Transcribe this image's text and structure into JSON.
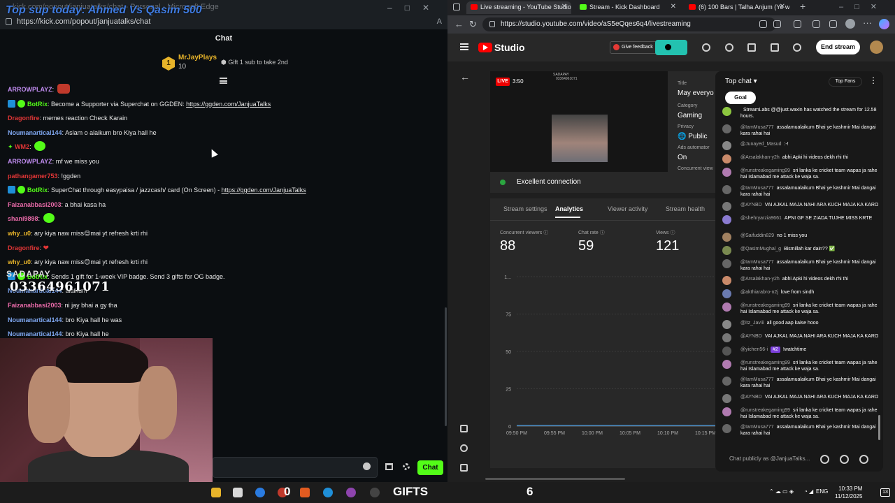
{
  "left": {
    "window_title": "kick.com/popout/janjuatalks/chat - Personal - Microsoft Edge",
    "overlay_title": "Top sup today: Ahmed Vs Qasim 500",
    "url": "https://kick.com/popout/janjuatalks/chat",
    "chat_header": "Chat",
    "pinned": {
      "rank": "1",
      "name": "MrJayPlays",
      "count": "10",
      "gift_text": "Gift 1 sub to take 2nd"
    },
    "messages": [
      {
        "user": "ARROWPLAYZ",
        "color": "#c08cf0",
        "text": "",
        "emote": "red"
      },
      {
        "user": "BotRix",
        "color": "#53fc18",
        "bot": true,
        "text": "Become a Supporter via Superchat on GGDEN: ",
        "link": "https://ggden.com/JanjuaTalks"
      },
      {
        "user": "Dragonfire",
        "color": "#e23636",
        "text": "memes reaction Check Karain"
      },
      {
        "user": "Noumanartical144",
        "color": "#7fa7f0",
        "text": "Aslam o alaikum bro Kiya hall he"
      },
      {
        "user": "WM2",
        "color": "#e23636",
        "star": true,
        "text": "",
        "emote": "green"
      },
      {
        "user": "ARROWPLAYZ",
        "color": "#c08cf0",
        "text": "mf we miss you"
      },
      {
        "user": "pathangamer753",
        "color": "#e23636",
        "text": "!ggden"
      },
      {
        "user": "BotRix",
        "color": "#53fc18",
        "bot": true,
        "text": "SuperChat through easypaisa / jazzcash/ card (On Screen) - ",
        "link": "https://ggden.com/JanjuaTalks"
      },
      {
        "user": "Faizanabbasi2003",
        "color": "#e86aa8",
        "text": "a bhai kasa ha"
      },
      {
        "user": "shani9898",
        "color": "#e86aa8",
        "text": "",
        "emote": "green"
      },
      {
        "user": "why_u0",
        "color": "#e8b42a",
        "text": "ary kiya naw miss😊mai yt refresh krti rhi"
      },
      {
        "user": "Dragonfire",
        "color": "#e23636",
        "text": "",
        "heart": true
      },
      {
        "user": "why_u0",
        "color": "#e8b42a",
        "text": "ary kiya naw miss😊mai yt refresh krti rhi"
      },
      {
        "user": "BotRix",
        "color": "#53fc18",
        "bot": true,
        "text": "Sends 1 gift for 1-week VIP badge. Send 3 gifts for OG badge."
      },
      {
        "user": "Noumanartical144",
        "color": "#7fa7f0",
        "text": "alaikum"
      },
      {
        "user": "Faizanabbasi2003",
        "color": "#e86aa8",
        "text": "ni jay bhai a gy tha"
      },
      {
        "user": "Noumanartical144",
        "color": "#7fa7f0",
        "text": "bro Kiya hall he was"
      },
      {
        "user": "Noumanartical144",
        "color": "#7fa7f0",
        "text": "bro Kiya hall he"
      }
    ],
    "sadapay_label": "SADAPAY",
    "phone_number": "03364961071",
    "chat_button": "Chat"
  },
  "right": {
    "tabs": [
      {
        "label": "Live streaming - YouTube Studio",
        "fav": "#ff0000",
        "active": true
      },
      {
        "label": "Stream - Kick Dashboard",
        "fav": "#53fc18",
        "active": false
      },
      {
        "label": "(6) 100 Bars | Talha Anjum (Ye w",
        "fav": "#ff0000",
        "active": false
      }
    ],
    "url": "https://studio.youtube.com/video/aS5eQqes6q4/livestreaming",
    "studio_label": "Studio",
    "feedback_label": "Give feedback",
    "end_stream_label": "End stream",
    "preview": {
      "live": "LIVE",
      "time": "3:50",
      "wm1": "SADAPAY",
      "wm2": "03364961071"
    },
    "meta": {
      "title_label": "Title",
      "title_value": "May everyo",
      "category_label": "Category",
      "category_value": "Gaming",
      "privacy_label": "Privacy",
      "privacy_value": "Public",
      "ads_label": "Ads automator",
      "ads_value": "On",
      "concurrent_label": "Concurrent view"
    },
    "connection": "Excellent connection",
    "panel_tabs": [
      "Stream settings",
      "Analytics",
      "Viewer activity",
      "Stream health"
    ],
    "stats": [
      {
        "label": "Concurrent viewers",
        "value": "88"
      },
      {
        "label": "Chat rate",
        "value": "59"
      },
      {
        "label": "Views",
        "value": "121"
      }
    ],
    "live_chat": {
      "header": "Top chat",
      "top_fans": "Top Fans",
      "goal": "Goal",
      "placeholder": "Chat publicly as @JanjuaTalks...",
      "messages": [
        {
          "author": "",
          "text": "StreamLabs @@just.waxin has watched the stream for 12.58 hours.",
          "color": "#8cc63f"
        },
        {
          "author": "@IamMusa777",
          "text": "assalamualaikum Bhai ye kashmir Mai dangai kara rahai hai",
          "color": "#666"
        },
        {
          "author": "@Junayed_Masud",
          "text": ":-!",
          "color": "#888"
        },
        {
          "author": "@Arsalakhan-y2h",
          "text": "abhi Apki hi videos dekh rhi thi",
          "color": "#c98a6a"
        },
        {
          "author": "@runstreakegaming99",
          "text": "sri lanka ke cricket team wapas ja rahe hai Islamabad me attack ke waja sa.",
          "color": "#b07ab0"
        },
        {
          "author": "@IamMusa777",
          "text": "assalamualaikum Bhai ye kashmir Mai dangai kara rahai hai",
          "color": "#666"
        },
        {
          "author": "@AYNBD",
          "text": "VAI AJKAL MAJA NAHI ARA KUCH MAJA KA KARO",
          "color": "#777"
        },
        {
          "author": "@shehryarzia9661",
          "text": "APNI GF SE ZIADA TUJHE MISS KRTE",
          "color": "#8a7ad0"
        },
        {
          "author": "@Saifuddin829",
          "text": "no 1 miss you",
          "color": "#a08060"
        },
        {
          "author": "@QasimMughal_g",
          "text": "Bismillah kar dain?? ✅",
          "color": "#7a8a50"
        },
        {
          "author": "@IamMusa777",
          "text": "assalamualaikum Bhai ye kashmir Mai dangai kara rahai hai",
          "color": "#666"
        },
        {
          "author": "@Arsalakhan-y2h",
          "text": "abhi Apki hi videos dekh rhi thi",
          "color": "#c98a6a"
        },
        {
          "author": "@akthiarabro-n2j",
          "text": "love from sindh",
          "color": "#6a7ab0"
        },
        {
          "author": "@runstreakegaming99",
          "text": "sri lanka ke cricket team wapas ja rahe hai Islamabad me attack ke waja sa.",
          "color": "#b07ab0"
        },
        {
          "author": "@itz_Javiii",
          "text": "all good aap kaise hooo",
          "color": "#888"
        },
        {
          "author": "@AYNBD",
          "text": "VAI AJKAL MAJA NAHI ARA KUCH MAJA KA KARO",
          "color": "#777"
        },
        {
          "author": "@yichen56-i",
          "mod": "#2",
          "text": "!watchtime",
          "color": "#555"
        },
        {
          "author": "@runstreakegaming99",
          "text": "sri lanka ke cricket team wapas ja rahe hai Islamabad me attack ke waja sa.",
          "color": "#b07ab0"
        },
        {
          "author": "@IamMusa777",
          "text": "assalamualaikum Bhai ye kashmir Mai dangai kara rahai hai",
          "color": "#666"
        },
        {
          "author": "@AYNBD",
          "text": "VAI AJKAL MAJA NAHI ARA KUCH MAJA KA KARO",
          "color": "#777"
        },
        {
          "author": "@runstreakegaming99",
          "text": "sri lanka ke cricket team wapas ja rahe hai Islamabad me attack ke waja sa.",
          "color": "#b07ab0"
        },
        {
          "author": "@IamMusa777",
          "text": "assalamualaikum Bhai ye kashmir Mai dangai kara rahai hai",
          "color": "#666"
        }
      ]
    }
  },
  "chart_data": {
    "type": "line",
    "y_ticks": [
      "0",
      "25",
      "50",
      "75",
      "1..."
    ],
    "x_ticks": [
      "09:50 PM",
      "09:55 PM",
      "10:00 PM",
      "10:05 PM",
      "10:10 PM",
      "10:15 PM"
    ],
    "ylim": [
      0,
      100
    ],
    "grid": true
  },
  "taskbar": {
    "overlay_count_left": "0",
    "gifts_label": "GIFTS",
    "overlay_count_right": "6",
    "lang": "ENG",
    "time": "10:33 PM",
    "date": "11/12/2025",
    "notifications": "13"
  }
}
